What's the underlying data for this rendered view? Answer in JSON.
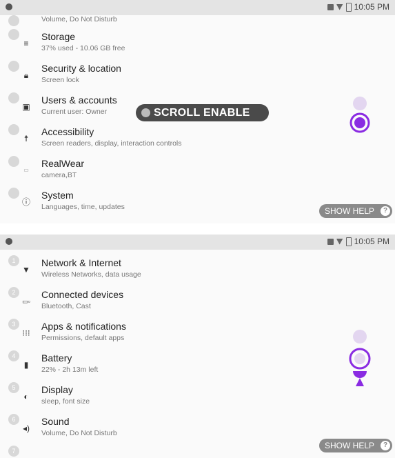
{
  "status": {
    "time": "10:05 PM"
  },
  "top": {
    "items": [
      {
        "title": "",
        "sub": "Volume, Do Not Disturb",
        "icon": "volume-icon",
        "badge": ""
      },
      {
        "title": "Storage",
        "sub": "37% used - 10.06 GB free",
        "icon": "storage-icon",
        "badge": ""
      },
      {
        "title": "Security & location",
        "sub": "Screen lock",
        "icon": "lock-icon",
        "badge": ""
      },
      {
        "title": "Users & accounts",
        "sub": "Current user: Owner",
        "icon": "user-icon",
        "badge": ""
      },
      {
        "title": "Accessibility",
        "sub": "Screen readers, display, interaction controls",
        "icon": "accessibility-icon",
        "badge": ""
      },
      {
        "title": "RealWear",
        "sub": "camera,BT",
        "icon": "realwear-icon",
        "badge": ""
      },
      {
        "title": "System",
        "sub": "Languages, time, updates",
        "icon": "info-icon",
        "badge": ""
      }
    ],
    "scroll_label": "SCROLL ENABLE",
    "help_label": "SHOW HELP",
    "help_icon": "?"
  },
  "bottom": {
    "items": [
      {
        "title": "Network & Internet",
        "sub": "Wireless Networks, data usage",
        "icon": "wifi-icon",
        "badge": "1"
      },
      {
        "title": "Connected devices",
        "sub": "Bluetooth, Cast",
        "icon": "devices-icon",
        "badge": "2"
      },
      {
        "title": "Apps & notifications",
        "sub": "Permissions, default apps",
        "icon": "apps-icon",
        "badge": "3"
      },
      {
        "title": "Battery",
        "sub": "22% - 2h 13m left",
        "icon": "battery-icon",
        "badge": "4"
      },
      {
        "title": "Display",
        "sub": "sleep, font size",
        "icon": "display-icon",
        "badge": "5"
      },
      {
        "title": "Sound",
        "sub": "Volume, Do Not Disturb",
        "icon": "sound-icon",
        "badge": "6"
      },
      {
        "title": "",
        "sub": "",
        "icon": "",
        "badge": "7"
      }
    ],
    "help_label": "SHOW HELP",
    "help_icon": "?"
  },
  "colors": {
    "accent": "#8a2be2",
    "accent_light": "#e3d6f0"
  }
}
